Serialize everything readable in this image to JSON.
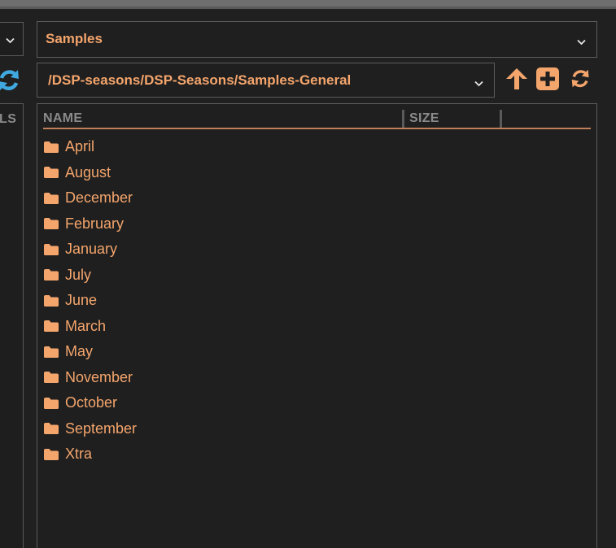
{
  "left_panel": {
    "column_header_fragment": "LS"
  },
  "source": {
    "selected": "Samples"
  },
  "path": {
    "selected": "/DSP-seasons/DSP-Seasons/Samples-General"
  },
  "toolbar": {
    "up_icon": "arrow-up-icon",
    "new_folder_icon": "plus-square-icon",
    "refresh_icon": "refresh-icon"
  },
  "file_list": {
    "columns": [
      "NAME",
      "SIZE"
    ],
    "items": [
      {
        "name": "April",
        "type": "folder"
      },
      {
        "name": "August",
        "type": "folder"
      },
      {
        "name": "December",
        "type": "folder"
      },
      {
        "name": "February",
        "type": "folder"
      },
      {
        "name": "January",
        "type": "folder"
      },
      {
        "name": "July",
        "type": "folder"
      },
      {
        "name": "June",
        "type": "folder"
      },
      {
        "name": "March",
        "type": "folder"
      },
      {
        "name": "May",
        "type": "folder"
      },
      {
        "name": "November",
        "type": "folder"
      },
      {
        "name": "October",
        "type": "folder"
      },
      {
        "name": "September",
        "type": "folder"
      },
      {
        "name": "Xtra",
        "type": "folder"
      }
    ]
  },
  "colors": {
    "accent": "#f4a56c",
    "refresh_blue": "#3fa9e0",
    "background": "#202020",
    "header_text": "#8a8a8a"
  }
}
